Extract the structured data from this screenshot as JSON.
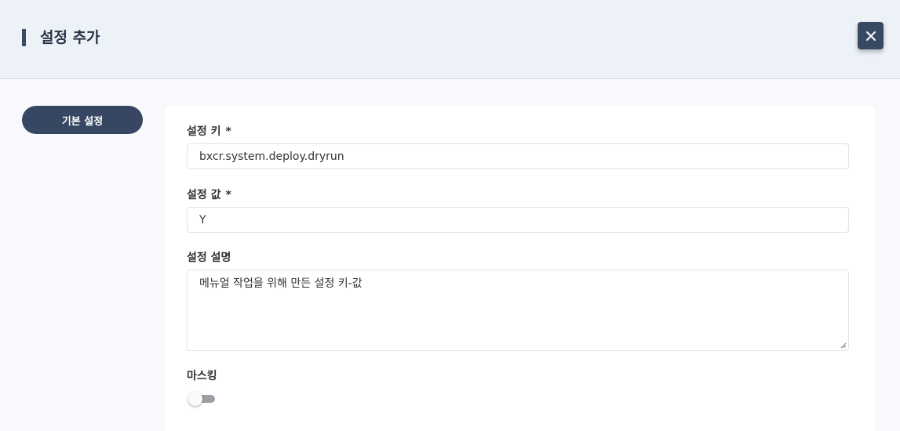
{
  "header": {
    "title": "설정 추가",
    "close_icon": "close-icon"
  },
  "tabs": [
    {
      "label": "기본 설정",
      "active": true
    }
  ],
  "form": {
    "key": {
      "label": "설정 키",
      "required_mark": "*",
      "value": "bxcr.system.deploy.dryrun"
    },
    "value": {
      "label": "설정 값",
      "required_mark": "*",
      "value": "Y"
    },
    "description": {
      "label": "설정 설명",
      "value": "메뉴얼 작업을 위해 만든 설정 키-값"
    },
    "masking": {
      "label": "마스킹",
      "checked": false
    }
  },
  "colors": {
    "accent": "#374761",
    "header_bg": "#edf2f8",
    "page_bg": "#f7f9fc"
  }
}
